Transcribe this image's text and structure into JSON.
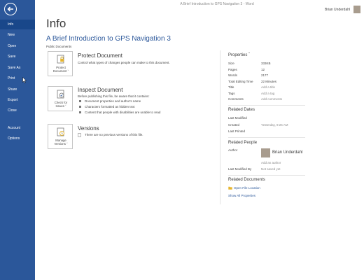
{
  "window": {
    "title": "A Brief Introduction to GPS Navigation 3 - Word",
    "user_name": "Brian Underdahl"
  },
  "sidebar": {
    "items": [
      {
        "label": "Info",
        "active": true
      },
      {
        "label": "New"
      },
      {
        "label": "Open"
      },
      {
        "label": "Save"
      },
      {
        "label": "Save As"
      },
      {
        "label": "Print"
      },
      {
        "label": "Share"
      },
      {
        "label": "Export"
      },
      {
        "label": "Close"
      },
      {
        "label": "Account"
      },
      {
        "label": "Options"
      }
    ]
  },
  "main": {
    "page_title": "Info",
    "doc_title": "A Brief Introduction to GPS Navigation 3",
    "doc_location": "Public Documents",
    "protect": {
      "button_line1": "Protect",
      "button_line2": "Document ˇ",
      "heading": "Protect Document",
      "description": "Control what types of changes people can make to this document."
    },
    "inspect": {
      "button_line1": "Check for",
      "button_line2": "Issues ˇ",
      "heading": "Inspect Document",
      "description": "Before publishing this file, be aware that it contains:",
      "bullets": [
        "Document properties and author's name",
        "Characters formatted as hidden text",
        "Content that people with disabilities are unable to read"
      ]
    },
    "versions": {
      "button_line1": "Manage",
      "button_line2": "Versions ˇ",
      "heading": "Versions",
      "description": "There are no previous versions of this file."
    }
  },
  "properties": {
    "heading": "Properties ˇ",
    "rows": [
      {
        "label": "Size",
        "value": "333KB"
      },
      {
        "label": "Pages",
        "value": "12"
      },
      {
        "label": "Words",
        "value": "2177"
      },
      {
        "label": "Total Editing Time",
        "value": "22 Minutes"
      },
      {
        "label": "Title",
        "value": "Add a title"
      },
      {
        "label": "Tags",
        "value": "Add a tag"
      },
      {
        "label": "Comments",
        "value": "Add comments"
      }
    ],
    "related_dates": {
      "heading": "Related Dates",
      "rows": [
        {
          "label": "Last Modified",
          "value": ""
        },
        {
          "label": "Created",
          "value": "Yesterday, 9:26 AM"
        },
        {
          "label": "Last Printed",
          "value": ""
        }
      ]
    },
    "related_people": {
      "heading": "Related People",
      "author_label": "Author",
      "author_name": "Brian Underdahl",
      "add_author": "Add an author",
      "last_modified_by_label": "Last Modified By",
      "last_modified_by_value": "Not saved yet"
    },
    "related_documents": {
      "heading": "Related Documents",
      "open_file_location": "Open File Location",
      "show_all": "Show All Properties"
    }
  },
  "colors": {
    "sidebar": "#2b579a",
    "sidebar_active": "#19478a",
    "accent": "#2b579a"
  },
  "icons": [
    "back-arrow-icon",
    "protect-lock-icon",
    "inspect-check-icon",
    "versions-history-icon",
    "folder-icon",
    "mouse-cursor-icon"
  ]
}
